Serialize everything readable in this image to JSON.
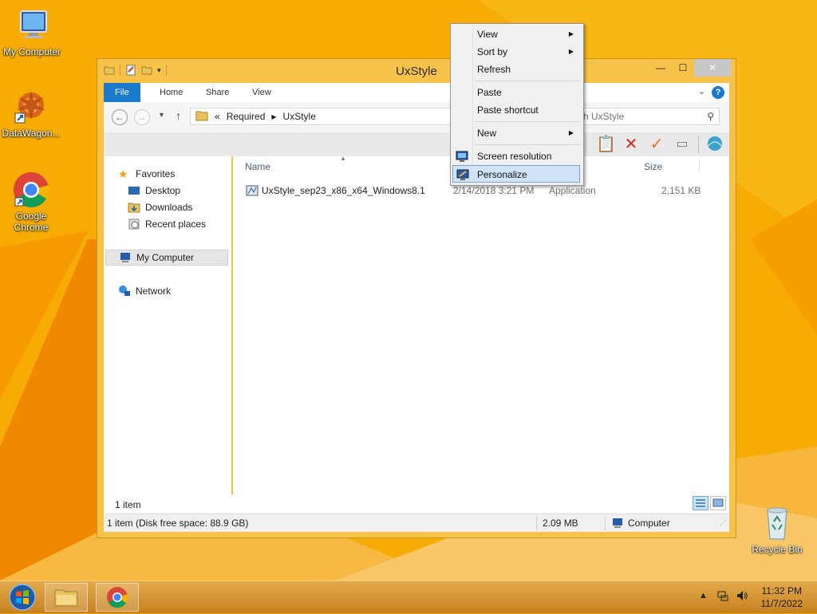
{
  "desktop": {
    "icons": [
      {
        "label": "My Computer"
      },
      {
        "label": "DataWagon..."
      },
      {
        "label": "Google Chrome"
      },
      {
        "label": "Recycle Bin"
      }
    ]
  },
  "window": {
    "title": "UxStyle",
    "ribbon_tabs": [
      "File",
      "Home",
      "Share",
      "View"
    ],
    "breadcrumb": {
      "prefix": "«",
      "parts": [
        "Required",
        "UxStyle"
      ]
    },
    "search_placeholder": "Search UxStyle",
    "search_visible_text": "ch UxStyle",
    "nav_pane": {
      "favorites": "Favorites",
      "favorites_items": [
        "Desktop",
        "Downloads",
        "Recent places"
      ],
      "my_computer": "My Computer",
      "network": "Network"
    },
    "columns": {
      "name": "Name",
      "size": "Size"
    },
    "files": [
      {
        "name": "UxStyle_sep23_x86_x64_Windows8.1",
        "date": "2/14/2018 3:21 PM",
        "type": "Application",
        "size": "2,151 KB"
      }
    ],
    "item_count": "1 item",
    "status": {
      "left": "1 item (Disk free space: 88.9 GB)",
      "size": "2.09 MB",
      "location": "Computer"
    }
  },
  "context_menu": {
    "items": [
      {
        "label": "View",
        "submenu": true
      },
      {
        "label": "Sort by",
        "submenu": true
      },
      {
        "label": "Refresh",
        "submenu": false
      },
      {
        "label": "Paste",
        "submenu": false
      },
      {
        "label": "Paste shortcut",
        "submenu": false
      },
      {
        "label": "New",
        "submenu": true
      },
      {
        "label": "Screen resolution",
        "submenu": false,
        "icon": "monitor-icon"
      },
      {
        "label": "Personalize",
        "submenu": false,
        "icon": "personalize-icon",
        "highlighted": true
      }
    ]
  },
  "taskbar": {
    "clock_time": "11:32 PM",
    "clock_date": "11/7/2022",
    "pinned": [
      "file-explorer",
      "google-chrome"
    ]
  },
  "colors": {
    "accent": "#1979ca",
    "desktop": "#f6a800",
    "highlight": "#d1e3f6"
  }
}
